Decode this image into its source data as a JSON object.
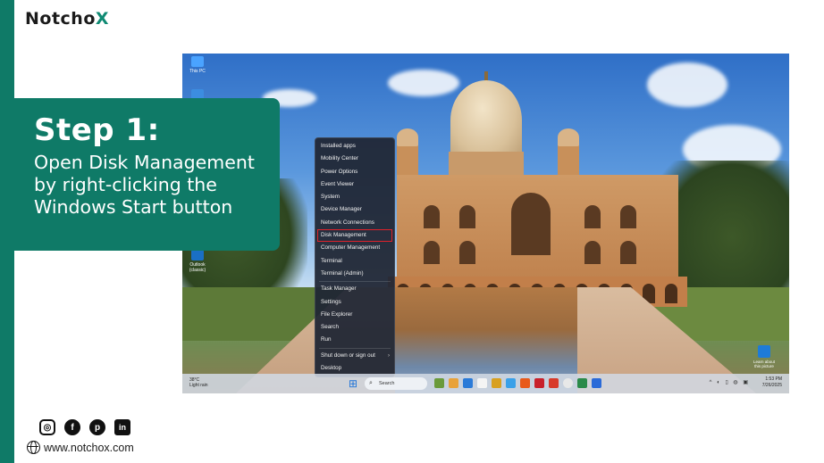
{
  "brand": {
    "logo_text": "Notcho",
    "logo_x": "X",
    "accent": "#0f7a67"
  },
  "step": {
    "title": "Step 1:",
    "text": "Open Disk Management by right-clicking the Windows Start button"
  },
  "desktop": {
    "icons": [
      {
        "label": "This PC",
        "icon": "this-pc-icon"
      },
      {
        "label": "",
        "icon": "network-icon"
      },
      {
        "label": "Outlook (classic)",
        "icon": "outlook-icon"
      }
    ],
    "notification": {
      "label": "Learn about this picture",
      "icon": "learn-about-picture-icon"
    }
  },
  "context_menu": {
    "items": [
      {
        "label": "Installed apps"
      },
      {
        "label": "Mobility Center"
      },
      {
        "label": "Power Options"
      },
      {
        "label": "Event Viewer"
      },
      {
        "label": "System"
      },
      {
        "label": "Device Manager"
      },
      {
        "label": "Network Connections"
      },
      {
        "label": "Disk Management",
        "highlighted": true
      },
      {
        "label": "Computer Management"
      },
      {
        "label": "Terminal"
      },
      {
        "label": "Terminal (Admin)"
      },
      {
        "label": "Task Manager"
      },
      {
        "label": "Settings"
      },
      {
        "label": "File Explorer"
      },
      {
        "label": "Search"
      },
      {
        "label": "Run"
      },
      {
        "label": "Shut down or sign out",
        "submenu": true
      },
      {
        "label": "Desktop"
      }
    ],
    "highlight_color": "#e0222a"
  },
  "taskbar": {
    "weather": {
      "temp": "38°C",
      "desc": "Light rain"
    },
    "search_placeholder": "Search",
    "clock": {
      "time": "1:53 PM",
      "date": "7/26/2025"
    }
  },
  "footer": {
    "social": [
      "instagram-icon",
      "facebook-icon",
      "pinterest-icon",
      "linkedin-icon"
    ],
    "website": "www.notchox.com"
  }
}
